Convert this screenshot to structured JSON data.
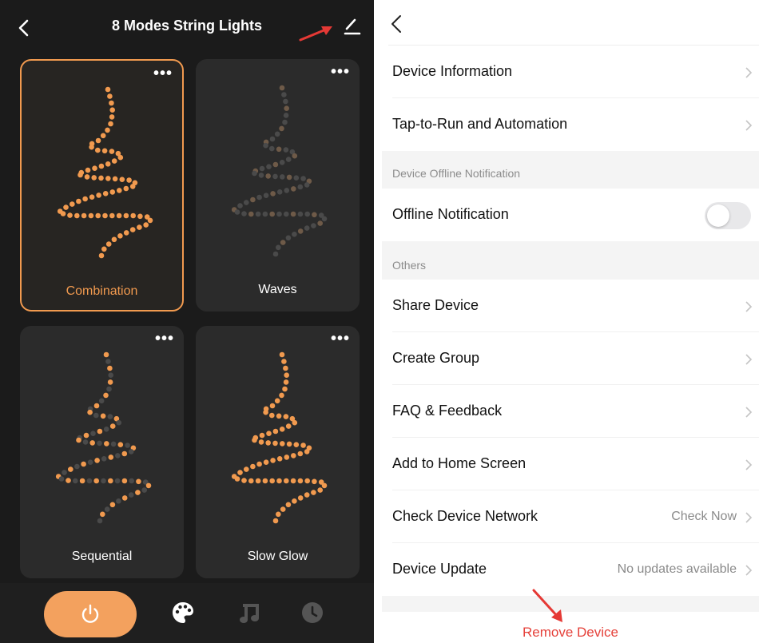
{
  "left_screen": {
    "title": "8 Modes String Lights",
    "more_icon": "ellipsis-icon",
    "modes": [
      {
        "label": "Combination",
        "state": "selected",
        "pattern": "all-lit"
      },
      {
        "label": "Waves",
        "state": "default",
        "pattern": "dim"
      },
      {
        "label": "Sequential",
        "state": "default",
        "pattern": "alternating"
      },
      {
        "label": "Slow Glow",
        "state": "default",
        "pattern": "all-lit"
      }
    ],
    "bottom_bar": {
      "icons": [
        "power-icon",
        "palette-icon",
        "music-icon",
        "clock-icon"
      ]
    }
  },
  "right_screen": {
    "items": [
      {
        "label": "Device Information",
        "value": "",
        "type": "link"
      },
      {
        "label": "Tap-to-Run and Automation",
        "value": "",
        "type": "link"
      }
    ],
    "offline_section": {
      "title": "Device Offline Notification",
      "toggle_label": "Offline Notification",
      "toggle_on": false
    },
    "others_section": {
      "title": "Others",
      "items": [
        {
          "label": "Share Device",
          "value": ""
        },
        {
          "label": "Create Group",
          "value": ""
        },
        {
          "label": "FAQ & Feedback",
          "value": ""
        },
        {
          "label": "Add to Home Screen",
          "value": ""
        },
        {
          "label": "Check Device Network",
          "value": "Check Now"
        },
        {
          "label": "Device Update",
          "value": "No updates available"
        }
      ]
    },
    "remove_label": "Remove Device"
  },
  "colors": {
    "accent_orange": "#f19a4f",
    "dark_bg": "#1b1b1b",
    "card_bg": "#2b2b2b",
    "dim_dot": "#4a4a4a",
    "dim_warm_dot": "#6e5a48",
    "remove_red": "#e5413a",
    "annotation_red": "#e53935"
  }
}
